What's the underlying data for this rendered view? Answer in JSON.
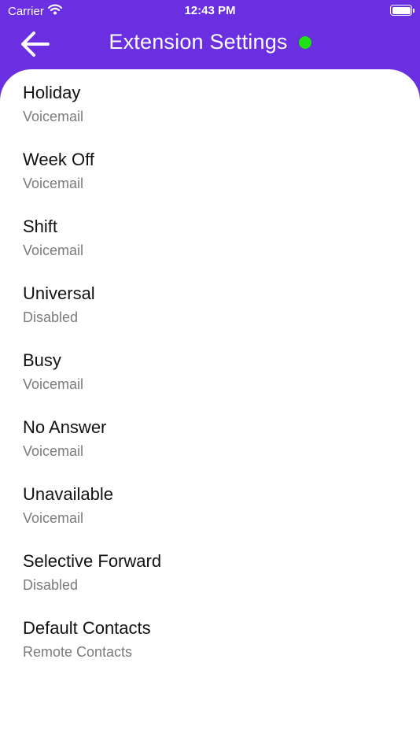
{
  "status_bar": {
    "carrier": "Carrier",
    "time": "12:43 PM",
    "icons": [
      "wifi-icon",
      "battery-icon"
    ]
  },
  "header": {
    "title": "Extension Settings",
    "back_icon": "arrow-left-icon",
    "status_indicator_color": "#22e016",
    "background_color": "#6a2fe0"
  },
  "settings": [
    {
      "title": "Holiday",
      "value": "Voicemail"
    },
    {
      "title": "Week Off",
      "value": "Voicemail"
    },
    {
      "title": "Shift",
      "value": "Voicemail"
    },
    {
      "title": "Universal",
      "value": "Disabled"
    },
    {
      "title": "Busy",
      "value": "Voicemail"
    },
    {
      "title": "No Answer",
      "value": "Voicemail"
    },
    {
      "title": "Unavailable",
      "value": "Voicemail"
    },
    {
      "title": "Selective Forward",
      "value": "Disabled"
    },
    {
      "title": "Default Contacts",
      "value": "Remote Contacts"
    }
  ]
}
